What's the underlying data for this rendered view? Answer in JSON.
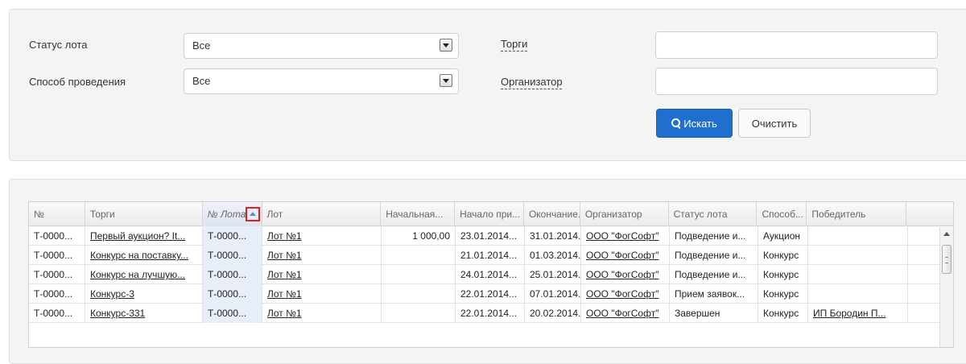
{
  "filters": {
    "lot_status_label": "Статус лота",
    "lot_status_value": "Все",
    "method_label": "Способ проведения",
    "method_value": "Все",
    "tenders_label": "Торги",
    "tenders_value": "",
    "organizer_label": "Организатор",
    "organizer_value": "",
    "search_button": "Искать",
    "clear_button": "Очистить"
  },
  "grid": {
    "columns": [
      "№",
      "Торги",
      "№ Лота",
      "Лот",
      "Начальная...",
      "Начало при...",
      "Окончание...",
      "Организатор",
      "Статус лота",
      "Способ...",
      "Победитель"
    ],
    "sorted_column": "№ Лота",
    "sort_direction": "ascending",
    "rows": [
      {
        "num": "Т-0000...",
        "tender": "Первый аукцион? It...",
        "lot_num": "Т-0000...",
        "lot": "Лот №1",
        "start_price": "1 000,00",
        "start": "23.01.2014...",
        "end": "31.01.2014...",
        "organizer": "ООО \"ФогСофт\"",
        "status": "Подведение и...",
        "method": "Аукцион",
        "winner": ""
      },
      {
        "num": "Т-0000...",
        "tender": "Конкурс на поставку...",
        "lot_num": "Т-0000...",
        "lot": "Лот №1",
        "start_price": "",
        "start": "21.01.2014...",
        "end": "01.03.2014...",
        "organizer": "ООО \"ФогСофт\"",
        "status": "Подведение и...",
        "method": "Конкурс",
        "winner": ""
      },
      {
        "num": "Т-0000...",
        "tender": "Конкурс на лучшую...",
        "lot_num": "Т-0000...",
        "lot": "Лот №1",
        "start_price": "",
        "start": "24.01.2014...",
        "end": "25.01.2014...",
        "organizer": "ООО \"ФогСофт\"",
        "status": "Подведение и...",
        "method": "Конкурс",
        "winner": ""
      },
      {
        "num": "Т-0000...",
        "tender": "Конкурс-3",
        "lot_num": "Т-0000...",
        "lot": "Лот №1",
        "start_price": "",
        "start": "22.01.2014...",
        "end": "07.01.2014...",
        "organizer": "ООО \"ФогСофт\"",
        "status": "Прием заявок...",
        "method": "Конкурс",
        "winner": ""
      },
      {
        "num": "Т-0000...",
        "tender": "Конкурс-331",
        "lot_num": "Т-0000...",
        "lot": "Лот №1",
        "start_price": "",
        "start": "22.01.2014...",
        "end": "20.02.2014...",
        "organizer": "ООО \"ФогСофт\"",
        "status": "Завершен",
        "method": "Конкурс",
        "winner": "ИП Бородин П..."
      }
    ]
  }
}
